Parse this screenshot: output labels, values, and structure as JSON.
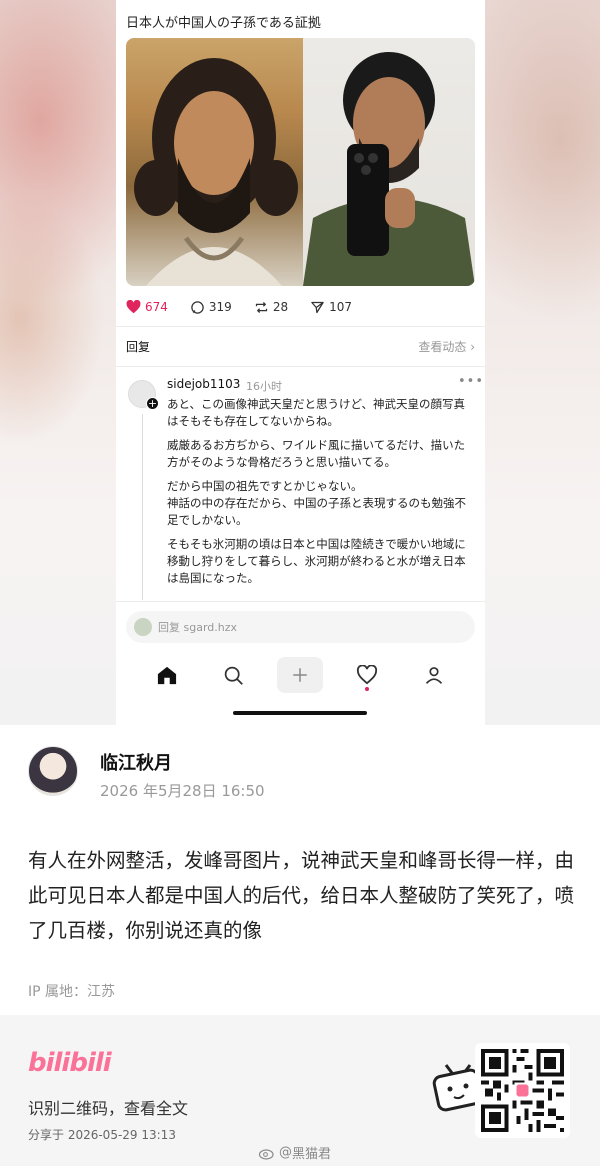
{
  "screenshot": {
    "post_title": "日本人が中国人の子孫である証拠",
    "stats": {
      "likes": "674",
      "comments": "319",
      "reposts": "28",
      "shares": "107"
    },
    "reply_label": "回复",
    "view_activity": "查看动态",
    "comment": {
      "username": "sidejob1103",
      "time": "16小时",
      "paragraphs": [
        "あと、この画像神武天皇だと思うけど、神武天皇の顔写真はそもそも存在してないからね。",
        "威厳あるお方ぢから、ワイルド風に描いてるだけ、描いた方がそのような骨格だろうと思い描いてる。",
        "だから中国の祖先ですとかじゃない。\n神話の中の存在だから、中国の子孫と表現するのも勉強不足でしかない。",
        "そもそも氷河期の頃は日本と中国は陸続きで暖かい地域に移動し狩りをして暮らし、氷河期が終わると水が増え日本は島国になった。"
      ]
    },
    "reply_placeholder": "回复 sgard.hzx"
  },
  "post": {
    "author": "临江秋月",
    "date": "2026 年5月28日 16:50",
    "text": "有人在外网整活，发峰哥图片，说神武天皇和峰哥长得一样，由此可见日本人都是中国人的后代，给日本人整破防了笑死了，喷了几百楼，你别说还真的像",
    "ip": "IP 属地：江苏"
  },
  "footer": {
    "logo": "bilibili",
    "scan_text": "识别二维码，查看全文",
    "share_text": "分享于 2026-05-29 13:13",
    "watermark": "黑猫君"
  },
  "colors": {
    "accent_like": "#e0245e",
    "bilibili_pink": "#fb7299"
  }
}
